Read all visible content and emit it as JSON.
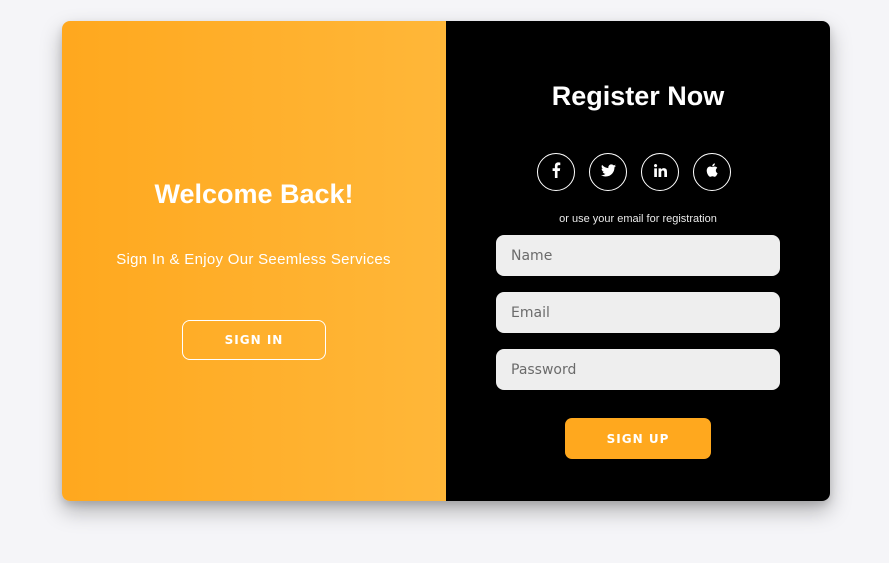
{
  "colors": {
    "accent": "#ffa81e",
    "accent_light": "#ffb739",
    "panel_dark": "#000000",
    "field_bg": "#eeeeee",
    "page_bg": "#f5f5f8"
  },
  "welcome": {
    "title": "Welcome Back!",
    "subtitle": "Sign In & Enjoy Our Seemless Services",
    "signin_label": "SIGN IN"
  },
  "register": {
    "title": "Register Now",
    "social": [
      {
        "icon": "facebook-icon",
        "glyph": "f"
      },
      {
        "icon": "twitter-icon",
        "glyph": "🐦"
      },
      {
        "icon": "linkedin-icon",
        "glyph": "in"
      },
      {
        "icon": "apple-icon",
        "glyph": ""
      }
    ],
    "or_text": "or use your email for registration",
    "fields": {
      "name_placeholder": "Name",
      "email_placeholder": "Email",
      "password_placeholder": "Password"
    },
    "signup_label": "SIGN UP"
  }
}
